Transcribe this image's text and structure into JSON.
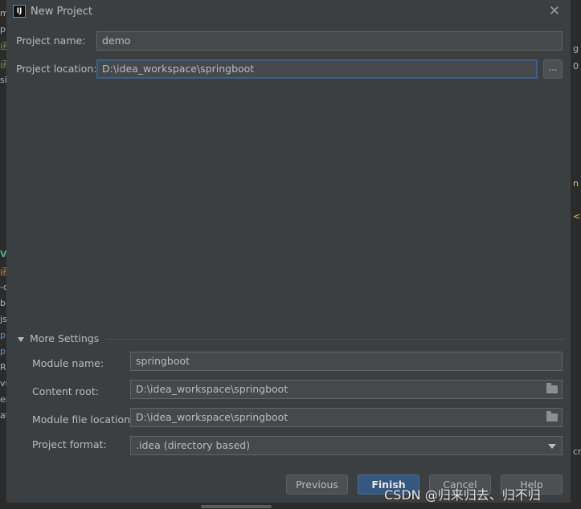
{
  "background": {
    "left_fragments": [
      "m",
      "p",
      "函",
      "函",
      "si",
      "V",
      "函",
      "-c",
      "b",
      "js",
      "p",
      "p",
      "R",
      "vu",
      "er",
      "at"
    ],
    "right_fragments": [
      "g",
      "0",
      "n",
      "<",
      "cr"
    ]
  },
  "dialog": {
    "title": "New Project",
    "app_icon_text": "IJ",
    "close_glyph": "✕"
  },
  "project": {
    "name_label": "Project name:",
    "name_value": "demo",
    "location_label": "Project location:",
    "location_value": "D:\\idea_workspace\\springboot",
    "browse_label": "..."
  },
  "more_settings": {
    "header": "More Settings",
    "module_name_label": "Module name:",
    "module_name_value": "springboot",
    "content_root_label": "Content root:",
    "content_root_value": "D:\\idea_workspace\\springboot",
    "module_file_label": "Module file location:",
    "module_file_value": "D:\\idea_workspace\\springboot",
    "format_label": "Project format:",
    "format_value": ".idea (directory based)"
  },
  "buttons": {
    "previous": "Previous",
    "finish": "Finish",
    "cancel": "Cancel",
    "help": "Help"
  },
  "watermark": "CSDN @归来归去、归不归",
  "colors": {
    "dialog_bg": "#3c3f41",
    "field_bg": "#45494a",
    "focus_border": "#3d6185",
    "primary_button": "#365880"
  }
}
